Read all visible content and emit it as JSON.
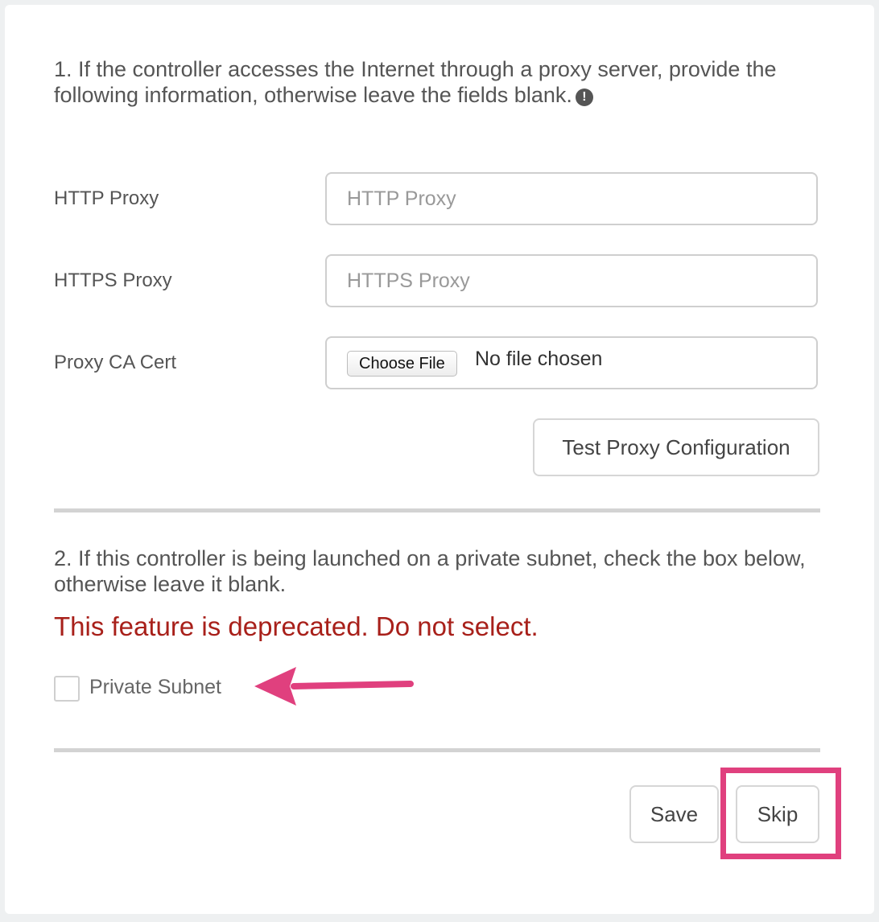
{
  "section1": {
    "text": "1. If the controller accesses the Internet through a proxy server, provide the following information, otherwise leave the fields blank.",
    "info_icon": "exclamation-circle-icon"
  },
  "form": {
    "http_proxy": {
      "label": "HTTP Proxy",
      "placeholder": "HTTP Proxy",
      "value": ""
    },
    "https_proxy": {
      "label": "HTTPS Proxy",
      "placeholder": "HTTPS Proxy",
      "value": ""
    },
    "proxy_ca_cert": {
      "label": "Proxy CA Cert",
      "button": "Choose File",
      "status": "No file chosen"
    },
    "test_button": "Test Proxy Configuration"
  },
  "section2": {
    "text": "2. If this controller is being launched on a private subnet, check the box below, otherwise leave it blank.",
    "warning": "This feature is deprecated. Do not select.",
    "checkbox_label": "Private Subnet",
    "checkbox_checked": false
  },
  "actions": {
    "save": "Save",
    "skip": "Skip"
  },
  "colors": {
    "warning": "#a8201a",
    "annotation": "#e0407e"
  }
}
